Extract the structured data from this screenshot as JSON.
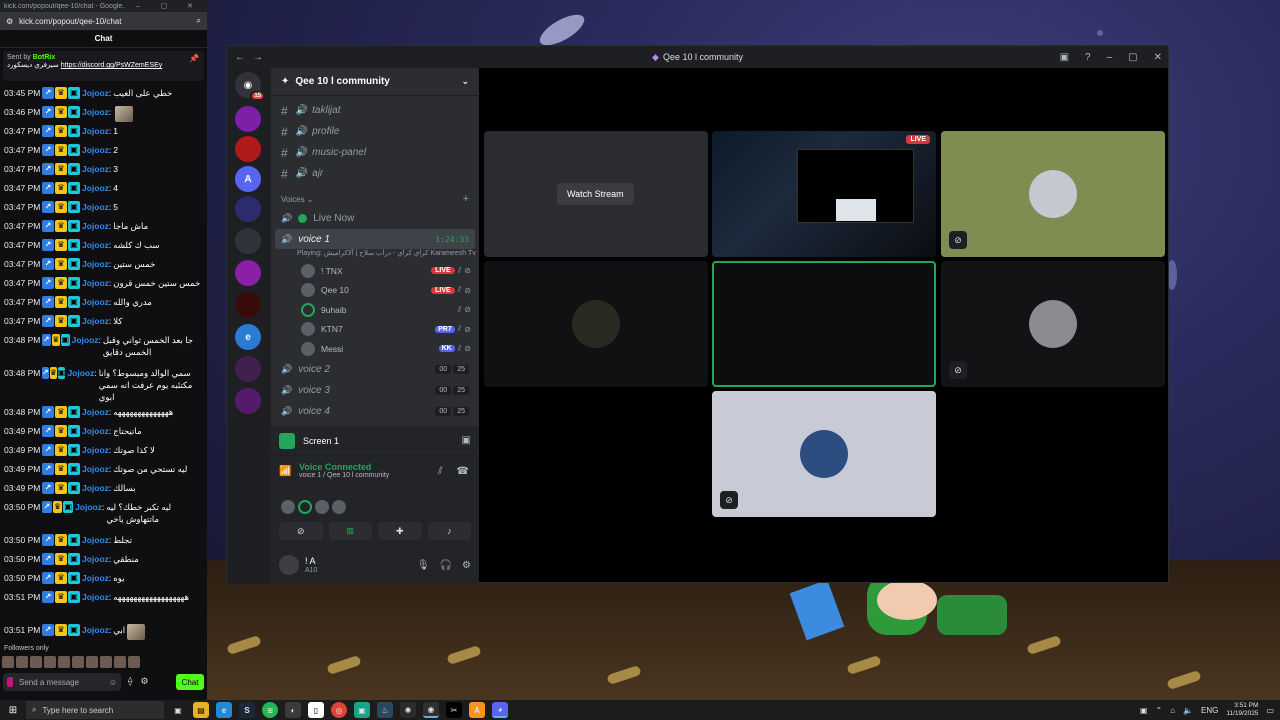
{
  "browser": {
    "tab_title": "kick.com/popout/qee-10/chat - Google...",
    "url": "kick.com/popout/qee-10/chat"
  },
  "chat": {
    "header": "Chat",
    "pinned": {
      "sent_by_prefix": "Sent by",
      "sent_by_name": "BotRix",
      "text": "سيرفري ديسكورد",
      "link": "https://discord.gg/PsWZemESEy"
    },
    "messages": [
      {
        "time": "03:45 PM",
        "user": "Jojooz",
        "text": "خطي على الغيب"
      },
      {
        "time": "03:46 PM",
        "user": "Jojooz",
        "text": "",
        "emote": true
      },
      {
        "time": "03:47 PM",
        "user": "Jojooz",
        "text": "1"
      },
      {
        "time": "03:47 PM",
        "user": "Jojooz",
        "text": "2"
      },
      {
        "time": "03:47 PM",
        "user": "Jojooz",
        "text": "3"
      },
      {
        "time": "03:47 PM",
        "user": "Jojooz",
        "text": "4"
      },
      {
        "time": "03:47 PM",
        "user": "Jojooz",
        "text": "5"
      },
      {
        "time": "03:47 PM",
        "user": "Jojooz",
        "text": "ماش ماجا"
      },
      {
        "time": "03:47 PM",
        "user": "Jojooz",
        "text": "سب ك كلشه"
      },
      {
        "time": "03:47 PM",
        "user": "Jojooz",
        "text": "خمس ستين"
      },
      {
        "time": "03:47 PM",
        "user": "Jojooz",
        "text": "خمس ستين خمس قرون"
      },
      {
        "time": "03:47 PM",
        "user": "Jojooz",
        "text": "مدري والله"
      },
      {
        "time": "03:47 PM",
        "user": "Jojooz",
        "text": "كلا"
      },
      {
        "time": "03:48 PM",
        "user": "Jojooz",
        "text": "جا بعد الخمس ثواني وقبل الخمس دقايق",
        "tall": true
      },
      {
        "time": "03:48 PM",
        "user": "Jojooz",
        "text": "سمي الوالد ومبسوط؟ وانا مكتئبه يوم عرفت انه سمي ابوي",
        "tall": true
      },
      {
        "time": "03:48 PM",
        "user": "Jojooz",
        "text": "ههههههههههههههه"
      },
      {
        "time": "03:49 PM",
        "user": "Jojooz",
        "text": "ماتيحتاج"
      },
      {
        "time": "03:49 PM",
        "user": "Jojooz",
        "text": "لا كذا صوتك"
      },
      {
        "time": "03:49 PM",
        "user": "Jojooz",
        "text": "ليه تستحي من صوتك"
      },
      {
        "time": "03:49 PM",
        "user": "Jojooz",
        "text": "بسالك"
      },
      {
        "time": "03:50 PM",
        "user": "Jojooz",
        "text": "ليه تكبر خطك؟ ليه ماتتهاوش ياخي",
        "tall": true
      },
      {
        "time": "03:50 PM",
        "user": "Jojooz",
        "text": "تجلط"
      },
      {
        "time": "03:50 PM",
        "user": "Jojooz",
        "text": "منطقي"
      },
      {
        "time": "03:50 PM",
        "user": "Jojooz",
        "text": "يوه"
      },
      {
        "time": "03:51 PM",
        "user": "Jojooz",
        "text": "ههههههههههههههههههه",
        "tall": true
      },
      {
        "time": "03:51 PM",
        "user": "Jojooz",
        "text": "ابي",
        "emote": true
      }
    ],
    "followers_only": "Followers only",
    "input_placeholder": "Send a message",
    "send_label": "Chat"
  },
  "discord": {
    "window_title": "Qee 10 l community",
    "guild_name": "Qee 10 l community",
    "server_badge": "15",
    "text_channels": [
      "taklijat",
      "profile",
      "music-panel",
      "ajr"
    ],
    "voices_label": "Voices",
    "live_now": "Live Now",
    "active_voice": {
      "name": "voice 1",
      "timer": "1:24:33",
      "playing": "Playing: كراي كراي - دراب سلاح | آلاكراميش Karameesh Tv"
    },
    "voice_users": [
      {
        "name": "! TNX",
        "live": "LIVE"
      },
      {
        "name": "Qee 10",
        "live": "LIVE"
      },
      {
        "name": "9uhaib",
        "live": ""
      },
      {
        "name": "KTN7",
        "tag": "PR7",
        "live": ""
      },
      {
        "name": "Messi",
        "tag": "KK",
        "live": ""
      }
    ],
    "other_voice": [
      {
        "name": "voice 2",
        "a": "00",
        "b": "25"
      },
      {
        "name": "voice 3",
        "a": "00",
        "b": "25"
      },
      {
        "name": "voice 4",
        "a": "00",
        "b": "25"
      }
    ],
    "screen_label": "Screen 1",
    "voice_connected": "Voice Connected",
    "voice_sub": "voice 1 / Qee 10 l community",
    "me": {
      "name": "! A",
      "status": "A10"
    },
    "watch_stream": "Watch Stream",
    "live_badge": "LIVE"
  },
  "taskbar": {
    "search_placeholder": "Type here to search",
    "lang": "ENG",
    "time": "3:51 PM",
    "date": "11/19/2025"
  }
}
